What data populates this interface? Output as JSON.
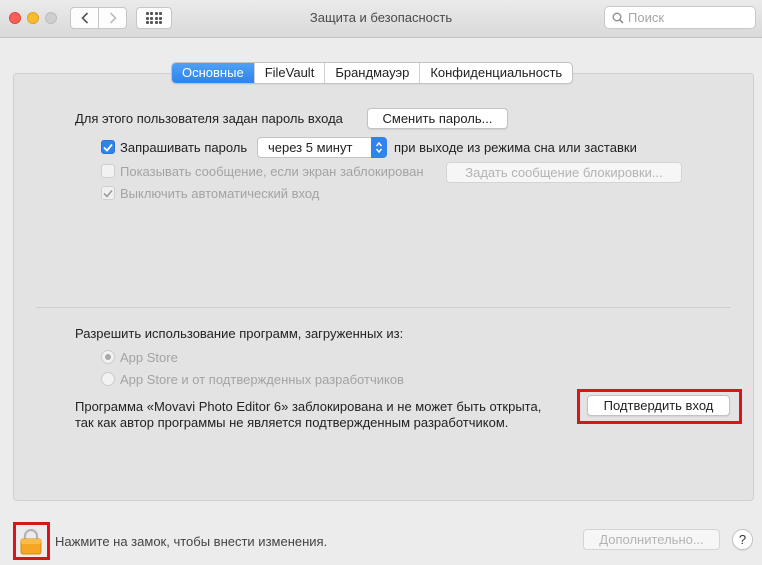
{
  "window": {
    "title": "Защита и безопасность",
    "search_placeholder": "Поиск"
  },
  "tabs": [
    {
      "label": "Основные",
      "active": true
    },
    {
      "label": "FileVault",
      "active": false
    },
    {
      "label": "Брандмауэр",
      "active": false
    },
    {
      "label": "Конфиденциальность",
      "active": false
    }
  ],
  "general": {
    "password_text": "Для этого пользователя задан пароль входа",
    "change_password_button": "Сменить пароль...",
    "require_password": {
      "label": "Запрашивать пароль",
      "checked": true
    },
    "require_password_delay": "через 5 минут",
    "require_password_suffix": "при выходе из режима сна или заставки",
    "show_message": {
      "label": "Показывать сообщение, если экран заблокирован",
      "checked": false,
      "enabled": false
    },
    "set_message_button": "Задать сообщение блокировки...",
    "disable_autologin": {
      "label": "Выключить автоматический вход",
      "checked": true,
      "enabled": false
    }
  },
  "apps": {
    "heading": "Разрешить использование программ, загруженных из:",
    "options": [
      {
        "label": "App Store",
        "selected": true
      },
      {
        "label": "App Store и от подтвержденных разработчиков",
        "selected": false
      }
    ],
    "blocked_line1": "Программа «Movavi Photo Editor 6» заблокирована и не может быть открыта,",
    "blocked_line2": "так как автор программы не является подтвержденным разработчиком.",
    "confirm_button": "Подтвердить вход"
  },
  "footer": {
    "lock_text": "Нажмите на замок, чтобы внести изменения.",
    "advanced_button": "Дополнительно...",
    "help_label": "?"
  },
  "colors": {
    "accent": "#2f83ea",
    "highlight": "#d9151c"
  }
}
